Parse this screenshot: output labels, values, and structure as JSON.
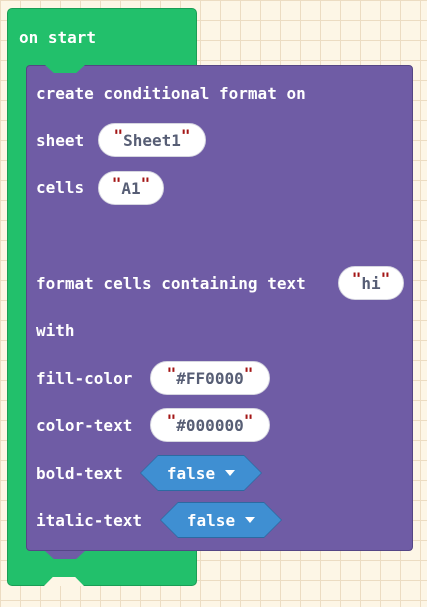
{
  "event": {
    "label": "on start"
  },
  "conditional_format": {
    "title": "create conditional format on",
    "sheet_label": "sheet",
    "sheet_value": "Sheet1",
    "cells_label": "cells",
    "cells_value": "A1",
    "rule_label": "format cells containing text",
    "rule_value": "hi",
    "with_label": "with",
    "fill_color_label": "fill-color",
    "fill_color_value": "#FF0000",
    "color_text_label": "color-text",
    "color_text_value": "#000000",
    "bold_label": "bold-text",
    "bold_value": "false",
    "italic_label": "italic-text",
    "italic_value": "false"
  },
  "colors": {
    "event_block": "#22c06b",
    "statement_block": "#6f5ca5",
    "boolean_block": "#3f8fd2",
    "string_quote": "#a31515",
    "workspace": "#fdf6e6"
  },
  "quote_mark": "\""
}
